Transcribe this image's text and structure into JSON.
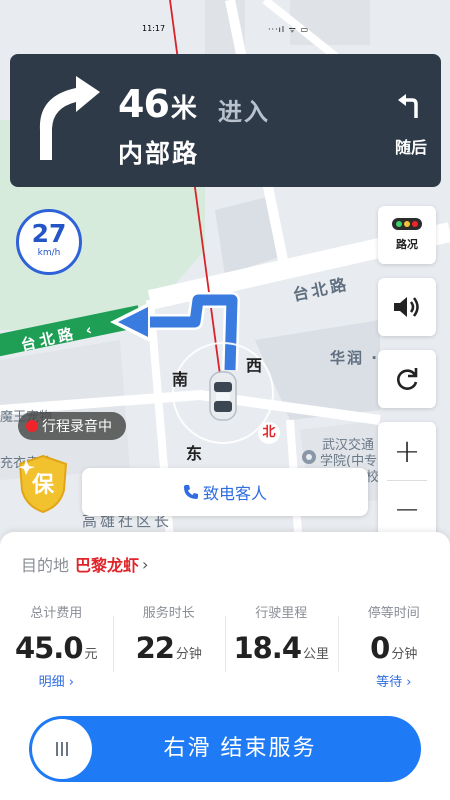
{
  "status_bar": {
    "time": "11:17",
    "icons": "···ıl ᯤ ▭"
  },
  "navigation": {
    "distance_value": "46",
    "distance_unit": "米",
    "action": "进入",
    "road": "内部路",
    "then_label": "随后"
  },
  "speed": {
    "value": "27",
    "unit": "km/h"
  },
  "map": {
    "road_green": "台北路 ‹",
    "road_upper": "台北路",
    "dir_south": "南",
    "dir_west": "西",
    "dir_east": "东",
    "dir_north": "北",
    "poi_huarun": "华润 · 橡",
    "poi_school": "武汉交通",
    "poi_school2": "学院(中专",
    "poi_school3": "校",
    "poi_museum": "魔王宠物",
    "poi_left": "充衣卖站",
    "poi_bottom": "高雄社区长"
  },
  "controls": {
    "traffic_label": "路况",
    "colors": {
      "accent": "#1f7bf5",
      "nav_bg": "#2e3a48",
      "record": "#f2242b",
      "destination": "#e0242a"
    }
  },
  "recording": {
    "label": "行程录音中"
  },
  "call": {
    "label": "致电客人"
  },
  "trip": {
    "destination_label": "目的地",
    "destination_name": "巴黎龙虾",
    "stats": [
      {
        "label": "总计费用",
        "value": "45.0",
        "unit": "元",
        "link": "明细 ›"
      },
      {
        "label": "服务时长",
        "value": "22",
        "unit": "分钟",
        "link": ""
      },
      {
        "label": "行驶里程",
        "value": "18.4",
        "unit": "公里",
        "link": ""
      },
      {
        "label": "停等时间",
        "value": "0",
        "unit": "分钟",
        "link": "等待 ›"
      }
    ]
  },
  "slider": {
    "label": "右滑 结束服务"
  }
}
